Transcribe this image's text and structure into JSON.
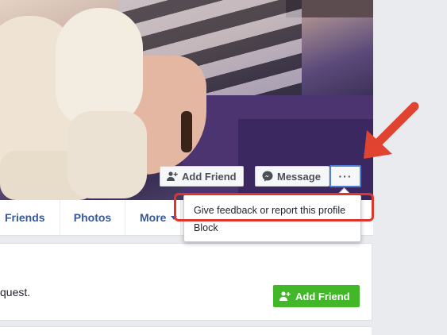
{
  "cover": {
    "add_friend_label": "Add Friend",
    "message_label": "Message",
    "more_label": "···"
  },
  "dropdown": {
    "items": [
      {
        "label": "Give feedback or report this profile"
      },
      {
        "label": "Block"
      }
    ]
  },
  "nav": {
    "tabs": [
      {
        "label": "Friends"
      },
      {
        "label": "Photos"
      },
      {
        "label": "More"
      }
    ]
  },
  "request": {
    "text": "quest.",
    "add_friend_label": "Add Friend"
  },
  "colors": {
    "highlight": "#e0352b",
    "link": "#365899",
    "green": "#42b72a",
    "focus": "#4f7ed6"
  },
  "icons": [
    "add-friend-icon",
    "messenger-icon",
    "arrow-annotation-icon"
  ]
}
